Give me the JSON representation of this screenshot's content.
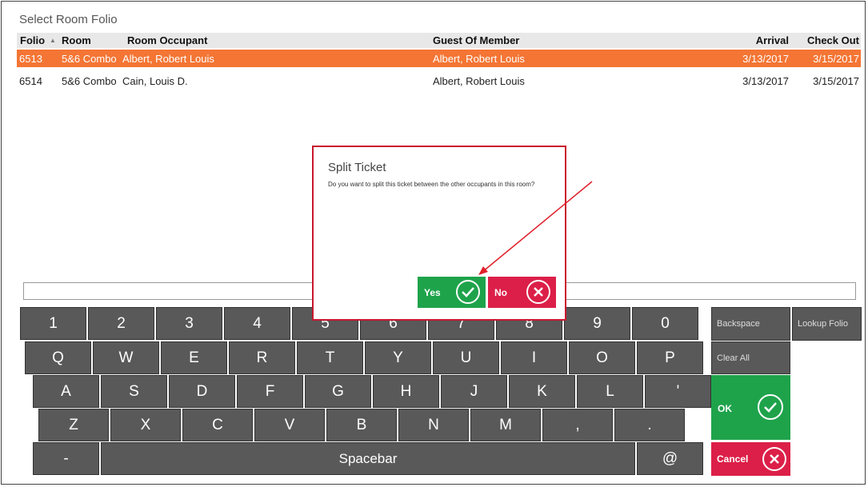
{
  "title": "Select Room Folio",
  "table": {
    "headers": {
      "folio": "Folio",
      "room": "Room",
      "occupant": "Room Occupant",
      "guest_of": "Guest Of Member",
      "arrival": "Arrival",
      "checkout": "Check Out"
    },
    "rows": [
      {
        "folio": "6513",
        "room": "5&6 Combo",
        "occupant": "Albert, Robert Louis",
        "guest_of": "Albert, Robert Louis",
        "arrival": "3/13/2017",
        "checkout": "3/15/2017",
        "selected": true
      },
      {
        "folio": "6514",
        "room": "5&6 Combo",
        "occupant": "Cain, Louis D.",
        "guest_of": "Albert, Robert Louis",
        "arrival": "3/13/2017",
        "checkout": "3/15/2017",
        "selected": false
      }
    ]
  },
  "search": {
    "value": ""
  },
  "keyboard": {
    "row1": [
      "1",
      "2",
      "3",
      "4",
      "5",
      "6",
      "7",
      "8",
      "9",
      "0"
    ],
    "row2": [
      "Q",
      "W",
      "E",
      "R",
      "T",
      "Y",
      "U",
      "I",
      "O",
      "P"
    ],
    "row3": [
      "A",
      "S",
      "D",
      "F",
      "G",
      "H",
      "J",
      "K",
      "L",
      "'"
    ],
    "row4": [
      "Z",
      "X",
      "C",
      "V",
      "B",
      "N",
      "M",
      ",",
      "."
    ],
    "dash": "-",
    "spacebar": "Spacebar",
    "at": "@",
    "backspace": "Backspace",
    "lookup_folio": "Lookup Folio",
    "clear_all": "Clear All",
    "ok": "OK",
    "cancel": "Cancel"
  },
  "dialog": {
    "title": "Split Ticket",
    "message": "Do you want to split this ticket between the other occupants in this room?",
    "yes": "Yes",
    "no": "No"
  },
  "colors": {
    "selected_row": "#f47534",
    "ok_green": "#1ea34b",
    "cancel_red": "#dc1f48",
    "key_gray": "#595959",
    "annotation_arrow": "#e0202a"
  }
}
